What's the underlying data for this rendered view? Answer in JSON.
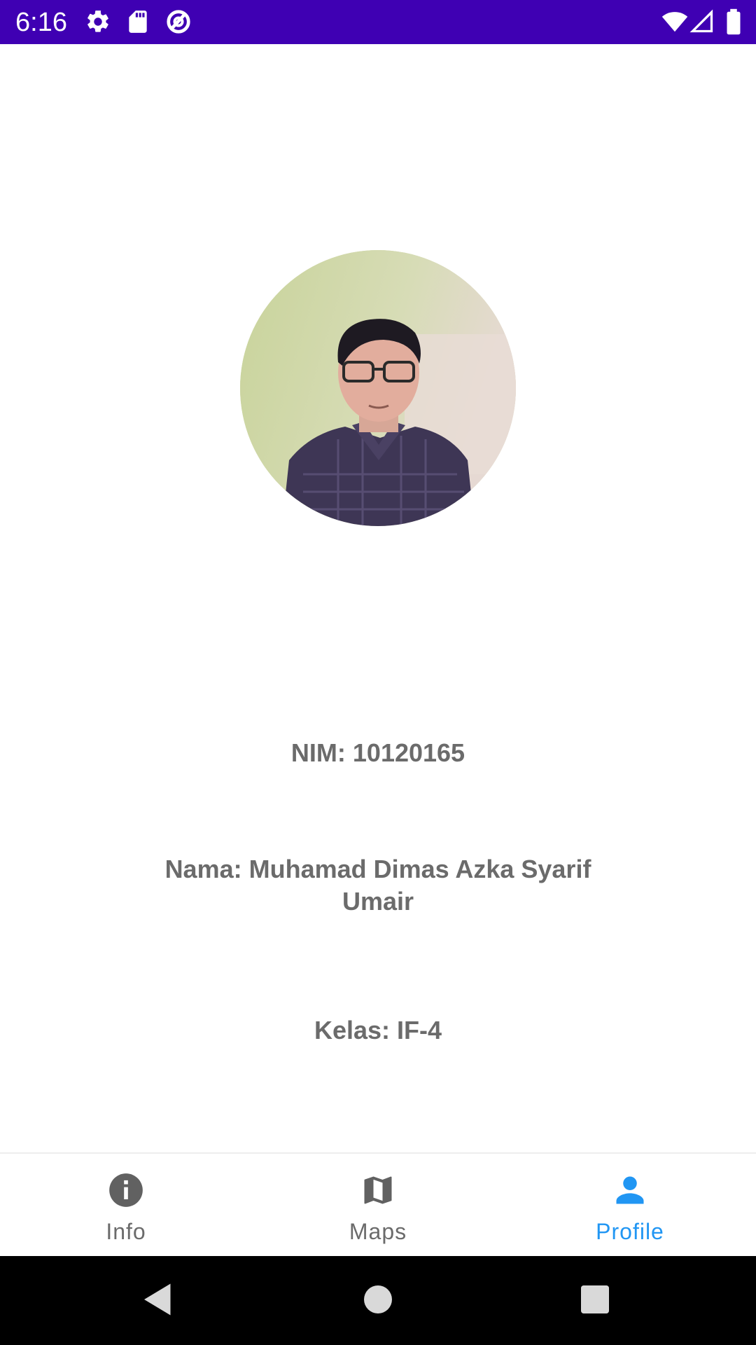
{
  "status_bar": {
    "time": "6:16",
    "background_color": "#3F00B3",
    "icons_left": [
      "gear-icon",
      "sd-card-icon",
      "data-saver-icon"
    ],
    "icons_right": [
      "wifi-icon",
      "cell-signal-icon",
      "battery-icon"
    ]
  },
  "profile": {
    "avatar_icon": "profile-photo",
    "nim": "NIM: 10120165",
    "nama": "Nama: Muhamad Dimas Azka Syarif Umair",
    "kelas": "Kelas: IF-4",
    "text_color": "#6b6b6b"
  },
  "bottom_nav": {
    "items": [
      {
        "label": "Info",
        "icon": "info-icon",
        "active": false
      },
      {
        "label": "Maps",
        "icon": "map-icon",
        "active": false
      },
      {
        "label": "Profile",
        "icon": "person-icon",
        "active": true
      }
    ],
    "active_color": "#2196F3",
    "inactive_color": "#6b6b6b"
  },
  "system_nav": {
    "buttons": [
      "back-icon",
      "home-icon",
      "recents-icon"
    ]
  }
}
